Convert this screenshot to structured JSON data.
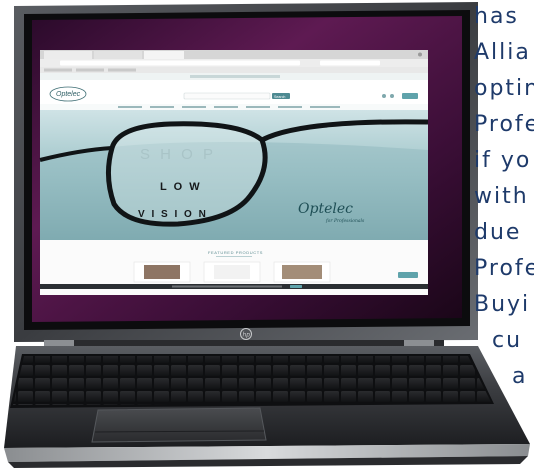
{
  "side_text": {
    "lines": [
      "has",
      "Allia",
      "optin",
      "Profe",
      "if yo",
      "with",
      "due",
      "Profe",
      "Buyi",
      "cu",
      "a"
    ]
  },
  "screen": {
    "logo": "Optelec",
    "logo_subtitle": "for Professionals",
    "hero_line_1": "S H O P",
    "hero_line_2": "L O W",
    "hero_line_3": "V I S I O N",
    "hero_brand": "Optelec",
    "hero_brand_subtitle": "for Professionals",
    "search_button": "Search",
    "section_title": "FEATURED PRODUCTS"
  },
  "laptop": {
    "brand_logo": "hp"
  }
}
